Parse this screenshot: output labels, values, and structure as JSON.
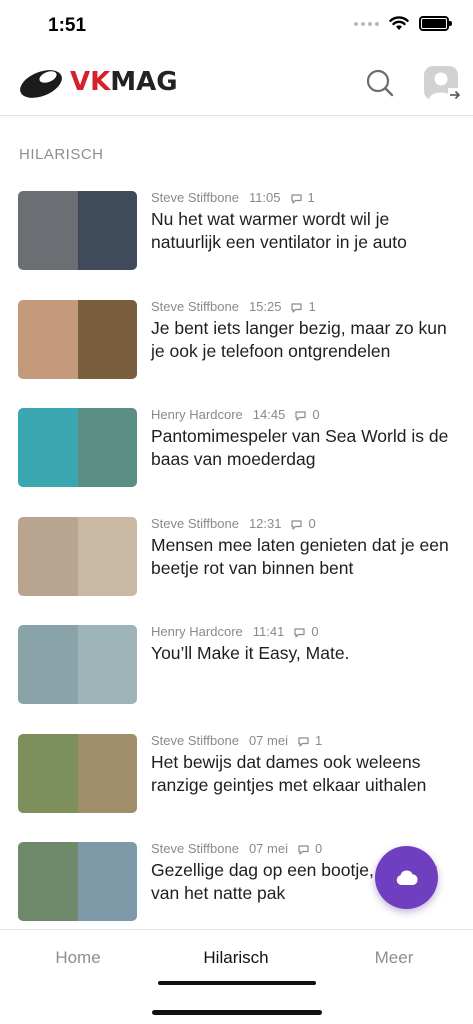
{
  "status_bar": {
    "time": "1:51"
  },
  "header": {
    "logo_vk": "VK",
    "logo_mag": "MAG",
    "search_icon": "search-icon",
    "profile_icon": "profile-login-icon"
  },
  "section": {
    "title": "HILARISCH"
  },
  "articles": [
    {
      "author": "Steve Stiffbone",
      "time": "11:05",
      "comments": "1",
      "title": "Nu het wat warmer wordt wil je natuurlijk een ventilator in je auto",
      "colors": [
        "#6b6f73",
        "#3f4b5a"
      ]
    },
    {
      "author": "Steve Stiffbone",
      "time": "15:25",
      "comments": "1",
      "title": "Je bent iets langer bezig, maar zo kun je ook je telefoon ontgrendelen",
      "colors": [
        "#c59a7a",
        "#7a5f3e"
      ]
    },
    {
      "author": "Henry Hardcore",
      "time": "14:45",
      "comments": "0",
      "title": "Pantomimespeler van Sea World is de baas van moederdag",
      "colors": [
        "#3aa6b0",
        "#5b8f86"
      ]
    },
    {
      "author": "Steve Stiffbone",
      "time": "12:31",
      "comments": "0",
      "title": "Mensen mee laten genieten dat je een beetje rot van binnen bent",
      "colors": [
        "#b9a58f",
        "#c9b8a4"
      ]
    },
    {
      "author": "Henry Hardcore",
      "time": "11:41",
      "comments": "0",
      "title": "You’ll Make it Easy, Mate.",
      "colors": [
        "#8aa3a8",
        "#9fb4b8"
      ]
    },
    {
      "author": "Steve Stiffbone",
      "time": "07 mei",
      "comments": "1",
      "title": "Het bewijs dat dames ook weleens ranzige geintjes met elkaar uithalen",
      "colors": [
        "#7d8f5a",
        "#a08d6a"
      ]
    },
    {
      "author": "Steve Stiffbone",
      "time": "07 mei",
      "comments": "0",
      "title": "Gezellige dag op een bootje, jammer van het natte pak",
      "colors": [
        "#6f8a6a",
        "#7e9aa8"
      ]
    }
  ],
  "fab": {
    "icon": "cloud-icon"
  },
  "tabs": [
    {
      "label": "Home",
      "active": false
    },
    {
      "label": "Hilarisch",
      "active": true
    },
    {
      "label": "Meer",
      "active": false
    }
  ],
  "colors": {
    "brand_red": "#d6202a",
    "fab_purple": "#6f3fc0"
  }
}
